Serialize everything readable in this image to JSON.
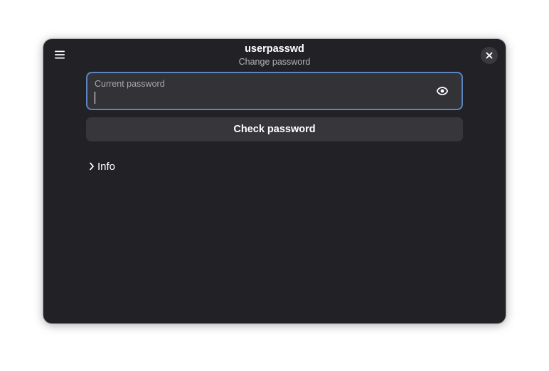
{
  "window": {
    "title": "userpasswd",
    "subtitle": "Change password"
  },
  "header": {
    "menu_icon": "hamburger-menu-icon",
    "close_icon": "close-icon"
  },
  "password_entry": {
    "label": "Current password",
    "value": "",
    "reveal_icon": "eye-icon"
  },
  "check_button": {
    "label": "Check password"
  },
  "info_expander": {
    "label": "Info",
    "expanded": false,
    "arrow_icon": "chevron-right-icon"
  },
  "colors": {
    "window_bg": "#222226",
    "entry_bg": "#333337",
    "focus_ring": "#5b84c0",
    "button_bg": "#37373b",
    "text_primary": "#ffffff",
    "text_secondary": "#b4b4b8"
  }
}
